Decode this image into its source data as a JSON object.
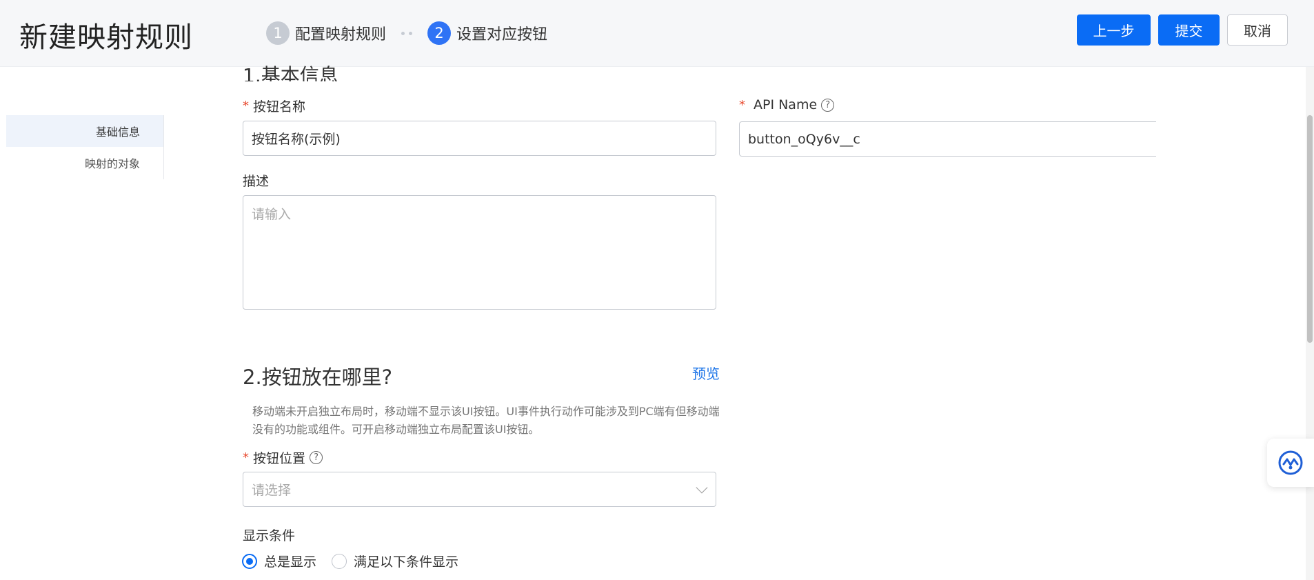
{
  "header": {
    "title": "新建映射规则",
    "steps": [
      {
        "num": "1",
        "label": "配置映射规则"
      },
      {
        "num": "2",
        "label": "设置对应按钮"
      }
    ],
    "buttons": {
      "prev": "上一步",
      "submit": "提交",
      "cancel": "取消"
    }
  },
  "left_nav": {
    "items": [
      {
        "label": "基础信息"
      },
      {
        "label": "映射的对象"
      }
    ]
  },
  "section1": {
    "title": "1.基本信息",
    "button_name": {
      "label": "按钮名称",
      "required": "*",
      "value": "按钮名称(示例)"
    },
    "api_name": {
      "label": "API Name",
      "required": "*",
      "value": "button_oQy6v__c"
    },
    "description": {
      "label": "描述",
      "placeholder": "请输入"
    }
  },
  "section2": {
    "title": "2.按钮放在哪里?",
    "preview": "预览",
    "hint": "移动端未开启独立布局时，移动端不显示该UI按钮。UI事件执行动作可能涉及到PC端有但移动端没有的功能或组件。可开启移动端独立布局配置该UI按钮。",
    "position": {
      "label": "按钮位置",
      "required": "*",
      "placeholder": "请选择"
    },
    "display_condition": {
      "label": "显示条件",
      "options": [
        {
          "label": "总是显示",
          "checked": true
        },
        {
          "label": "满足以下条件显示",
          "checked": false
        }
      ]
    }
  },
  "colors": {
    "primary": "#0a6cf5",
    "required": "#e8492e",
    "link": "#1a73e8"
  }
}
